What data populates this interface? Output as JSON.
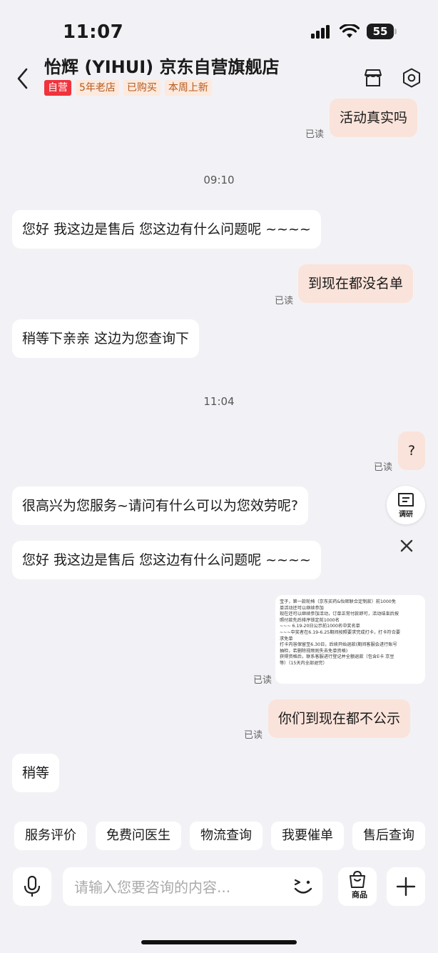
{
  "status_bar": {
    "time": "11:07",
    "battery": "55"
  },
  "header": {
    "shop_name": "怡辉 (YIHUI) 京东自营旗舰店",
    "tags": [
      "自营",
      "5年老店",
      "已购买",
      "本周上新"
    ]
  },
  "read_label": "已读",
  "timestamps": [
    "09:10",
    "11:04"
  ],
  "messages": [
    {
      "side": "right",
      "text": "活动真实吗",
      "read": true
    },
    {
      "side": "left",
      "text": "您好 我这边是售后 您这边有什么问题呢 ~~~~"
    },
    {
      "side": "right",
      "text": "到现在都没名单",
      "read": true
    },
    {
      "side": "left",
      "text": "稍等下亲亲  这边为您查询下"
    },
    {
      "side": "right",
      "text": "?",
      "read": true
    },
    {
      "side": "left",
      "text": "很高兴为您服务~请问有什么可以为您效劳呢?"
    },
    {
      "side": "left",
      "text": "您好 我这边是售后 您这边有什么问题呢 ~~~~"
    },
    {
      "side": "right",
      "text": "你们到现在都不公示",
      "read": true
    },
    {
      "side": "left",
      "text": "稍等"
    }
  ],
  "image_message_lines": [
    "宝子，第一款轮椅（京东买药&怡辉联合定制款）前1000免",
    "单活动还可以继续参加",
    "现在还可以继续参加活动，订单正常付款即可，活动结束后按",
    "照付款先后排序锁定前1000名",
    "~~~ 6.19-20日公示前1000名中奖名单",
    "~~~中奖者在6.19-6.25期间按照要求完成打卡，打卡符合要",
    "求免单",
    "打卡内容保留至6.30日，后续开始退款(期间客服会进行账号",
    "抽检，若删除视频则失去免单资格)",
    "获得资格后，联系客服进行登记并全额退款（包含E卡 京豆",
    "等）（15天内全部退完）"
  ],
  "survey_label": "调研",
  "quick_actions": [
    "服务评价",
    "免费问医生",
    "物流查询",
    "我要催单",
    "售后查询"
  ],
  "input": {
    "placeholder": "请输入您要咨询的内容..."
  },
  "goods_label": "商品"
}
